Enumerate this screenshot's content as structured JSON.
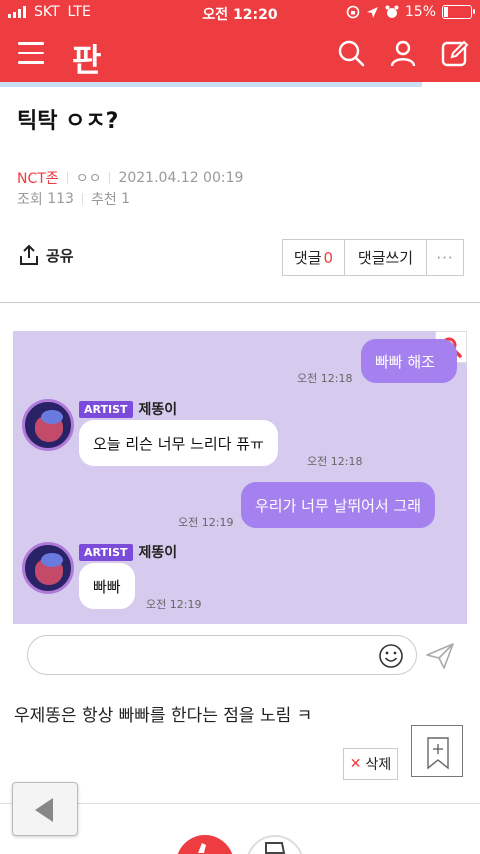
{
  "status_bar": {
    "carrier": "SKT",
    "network": "LTE",
    "time": "오전 12:20",
    "battery_text": "15%",
    "battery_level": 0.15
  },
  "header": {
    "logo": "판",
    "icons": [
      "menu-icon",
      "search-icon",
      "user-icon",
      "edit-icon"
    ]
  },
  "read_progress": 0.88,
  "post": {
    "title": "틱탁 ㅇㅈ?",
    "author": "NCT존",
    "nickname": "ㅇㅇ",
    "date": "2021.04.12 00:19",
    "views_label": "조회",
    "views": "113",
    "recommend_label": "추천",
    "recommend": "1",
    "share_label": "공유",
    "comment_label": "댓글",
    "comment_count": "0",
    "write_comment_label": "댓글쓰기",
    "more_label": "···"
  },
  "chat": {
    "messages": [
      {
        "side": "me",
        "text": "빠빠 해조",
        "time": "오전 12:18"
      },
      {
        "side": "them",
        "badge": "ARTIST",
        "sender": "제똥이",
        "text": "오늘 리슨 너무 느리다 퓨ㅠ",
        "time": "오전 12:18"
      },
      {
        "side": "me",
        "text": "우리가 너무 날뛰어서 그래",
        "time": "오전 12:19"
      },
      {
        "side": "them",
        "badge": "ARTIST",
        "sender": "제똥이",
        "text": "빠빠",
        "time": "오전 12:19"
      }
    ]
  },
  "body_text": "우제똥은 항상 빠빠를 한다는 점을 노림 ㅋ",
  "delete_label": "삭제",
  "colors": {
    "brand": "#ee3d41",
    "chat_bg": "#d6cbee",
    "my_bubble": "#a481ee",
    "artist_badge": "#7b4cd9"
  }
}
